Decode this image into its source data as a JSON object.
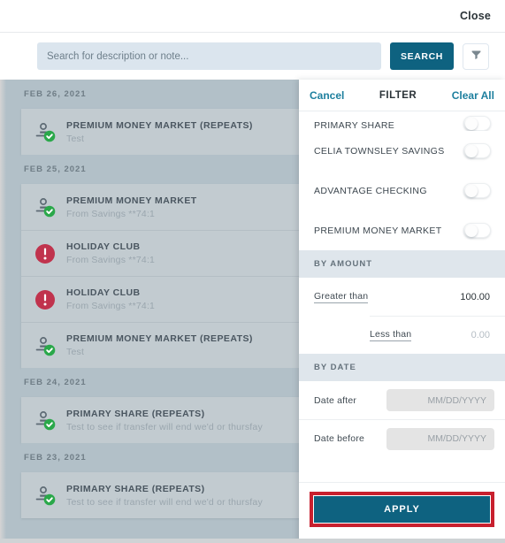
{
  "window": {
    "close_label": "Close"
  },
  "search": {
    "placeholder": "Search for description or note...",
    "value": "",
    "search_button": "SEARCH",
    "filter_icon": "filter-funnel-icon"
  },
  "transactions": {
    "groups": [
      {
        "date": "FEB 26, 2021",
        "items": [
          {
            "title": "PREMIUM MONEY MARKET (REPEATS)",
            "subtitle": "Test",
            "status": "success"
          }
        ]
      },
      {
        "date": "FEB 25, 2021",
        "items": [
          {
            "title": "PREMIUM MONEY MARKET",
            "subtitle": "From Savings **74:1",
            "status": "success"
          },
          {
            "title": "HOLIDAY CLUB",
            "subtitle": "From Savings **74:1",
            "status": "alert"
          },
          {
            "title": "HOLIDAY CLUB",
            "subtitle": "From Savings **74:1",
            "status": "alert"
          },
          {
            "title": "PREMIUM MONEY MARKET (REPEATS)",
            "subtitle": "Test",
            "status": "success"
          }
        ]
      },
      {
        "date": "FEB 24, 2021",
        "items": [
          {
            "title": "PRIMARY SHARE (REPEATS)",
            "subtitle": "Test to see if transfer will end we'd or thursfay",
            "status": "success"
          }
        ]
      },
      {
        "date": "FEB 23, 2021",
        "items": [
          {
            "title": "PRIMARY SHARE (REPEATS)",
            "subtitle": "Test to see if transfer will end we'd or thursfay",
            "status": "success"
          }
        ]
      }
    ]
  },
  "filter": {
    "cancel_label": "Cancel",
    "title": "FILTER",
    "clear_all_label": "Clear All",
    "accounts": [
      {
        "label": "PRIMARY SHARE",
        "on": false,
        "clipped": true
      },
      {
        "label": "CELIA TOWNSLEY SAVINGS",
        "on": false
      },
      {
        "label": "ADVANTAGE CHECKING",
        "on": false
      },
      {
        "label": "PREMIUM MONEY MARKET",
        "on": false
      }
    ],
    "by_amount": {
      "section_label": "BY AMOUNT",
      "greater_than_label": "Greater than",
      "greater_than_value": "100.00",
      "less_than_label": "Less than",
      "less_than_value": "0.00"
    },
    "by_date": {
      "section_label": "BY DATE",
      "date_after_label": "Date after",
      "date_after_value": "",
      "date_after_placeholder": "MM/DD/YYYY",
      "date_before_label": "Date before",
      "date_before_value": "",
      "date_before_placeholder": "MM/DD/YYYY"
    },
    "apply_label": "APPLY"
  },
  "colors": {
    "accent_teal": "#0e6280",
    "link_teal": "#1d7f9e",
    "highlight_red": "#c8202e",
    "success_green": "#2aa84a",
    "alert_crimson": "#c0334d",
    "dim_overlay": "#b2c0c8"
  }
}
